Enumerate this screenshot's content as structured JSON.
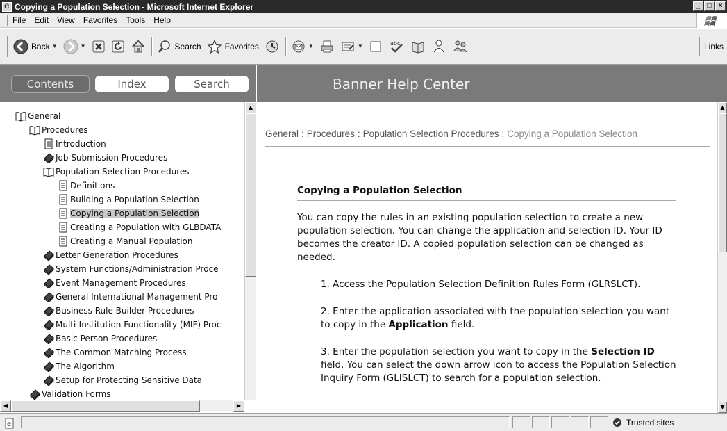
{
  "window": {
    "title": "Copying a Population Selection - Microsoft Internet Explorer",
    "buttons": {
      "minimize": "_",
      "maximize": "□",
      "close": "×"
    }
  },
  "menubar": {
    "items": [
      "File",
      "Edit",
      "View",
      "Favorites",
      "Tools",
      "Help"
    ]
  },
  "toolbar": {
    "back_label": "Back",
    "search_label": "Search",
    "favorites_label": "Favorites",
    "links_label": "Links"
  },
  "nav_tabs": {
    "contents": "Contents",
    "index": "Index",
    "search": "Search",
    "active": "Contents"
  },
  "header": {
    "title": "Banner Help Center"
  },
  "tree": [
    {
      "label": "General",
      "level": 0,
      "icon": "open-book-icon"
    },
    {
      "label": "Procedures",
      "level": 1,
      "icon": "open-book-icon"
    },
    {
      "label": "Introduction",
      "level": 2,
      "icon": "page-icon"
    },
    {
      "label": "Job Submission Procedures",
      "level": 2,
      "icon": "closed-book-icon"
    },
    {
      "label": "Population Selection Procedures",
      "level": 2,
      "icon": "open-book-icon"
    },
    {
      "label": "Definitions",
      "level": 3,
      "icon": "page-icon"
    },
    {
      "label": "Building a Population Selection",
      "level": 3,
      "icon": "page-icon"
    },
    {
      "label": "Copying a Population Selection",
      "level": 3,
      "icon": "page-icon",
      "selected": true
    },
    {
      "label": "Creating a Population with GLBDATA",
      "level": 3,
      "icon": "page-icon"
    },
    {
      "label": "Creating a Manual Population",
      "level": 3,
      "icon": "page-icon"
    },
    {
      "label": "Letter Generation Procedures",
      "level": 2,
      "icon": "closed-book-icon"
    },
    {
      "label": "System Functions/Administration Proce",
      "level": 2,
      "icon": "closed-book-icon"
    },
    {
      "label": "Event Management Procedures",
      "level": 2,
      "icon": "closed-book-icon"
    },
    {
      "label": "General International Management Pro",
      "level": 2,
      "icon": "closed-book-icon"
    },
    {
      "label": "Business Rule Builder Procedures",
      "level": 2,
      "icon": "closed-book-icon"
    },
    {
      "label": "Multi-Institution Functionality (MIF) Proc",
      "level": 2,
      "icon": "closed-book-icon"
    },
    {
      "label": "Basic Person Procedures",
      "level": 2,
      "icon": "closed-book-icon"
    },
    {
      "label": "The Common Matching Process",
      "level": 2,
      "icon": "closed-book-icon"
    },
    {
      "label": "The Algorithm",
      "level": 2,
      "icon": "closed-book-icon"
    },
    {
      "label": "Setup for Protecting Sensitive Data",
      "level": 2,
      "icon": "closed-book-icon"
    },
    {
      "label": "Validation Forms",
      "level": 1,
      "icon": "closed-book-icon"
    }
  ],
  "breadcrumb": {
    "items": [
      "General",
      "Procedures",
      "Population Selection Procedures"
    ],
    "current": "Copying a Population Selection",
    "separator": ":"
  },
  "article": {
    "heading": "Copying a Population Selection",
    "intro": "You can copy the rules in an existing population selection to create a new population selection. You can change the application and selection ID. Your ID becomes the creator ID. A copied population selection can be changed as needed.",
    "step1": "1. Access the Population Selection Definition Rules Form (GLRSLCT).",
    "step2_before": "2. Enter the application associated with the population selection you want to copy in the ",
    "step2_bold": "Application",
    "step2_after": " field.",
    "step3_before": "3. Enter the population selection you want to copy in the ",
    "step3_bold": "Selection ID",
    "step3_after": " field. You can select the down arrow icon to access the Population Selection Inquiry Form (GLISLCT) to search for a population selection."
  },
  "statusbar": {
    "zone": "Trusted sites"
  },
  "colors": {
    "band": "#7a7a7a",
    "selection": "#c8c8c8",
    "titlebar": "#2a2a2a"
  }
}
